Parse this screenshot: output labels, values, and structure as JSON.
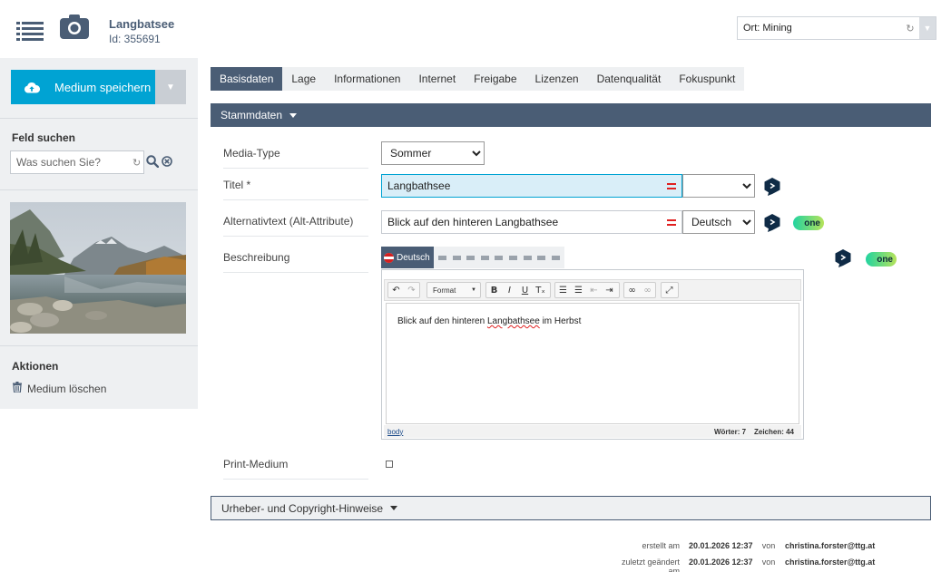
{
  "header": {
    "title": "Langbatsee",
    "id_label": "Id: 355691",
    "location_select": "Ort: Mining"
  },
  "sidebar": {
    "save_label": "Medium speichern",
    "search_heading": "Feld suchen",
    "search_placeholder": "Was suchen Sie?",
    "actions_heading": "Aktionen",
    "delete_label": "Medium löschen"
  },
  "tabs": [
    {
      "label": "Basisdaten",
      "active": true
    },
    {
      "label": "Lage"
    },
    {
      "label": "Informationen"
    },
    {
      "label": "Internet"
    },
    {
      "label": "Freigabe"
    },
    {
      "label": "Lizenzen"
    },
    {
      "label": "Datenqualität"
    },
    {
      "label": "Fokuspunkt"
    }
  ],
  "section": {
    "title": "Stammdaten"
  },
  "fields": {
    "media_type": {
      "label": "Media-Type",
      "value": "Sommer"
    },
    "title": {
      "label": "Titel *",
      "value": "Langbathsee",
      "lang": ""
    },
    "alt_text": {
      "label": "Alternativtext (Alt-Attribute)",
      "value": "Blick auf den hinteren Langbathsee",
      "lang": "Deutsch"
    },
    "description": {
      "label": "Beschreibung",
      "lang_tab": "Deutsch"
    },
    "print": {
      "label": "Print-Medium"
    }
  },
  "editor": {
    "format_label": "Format",
    "content_before": "Blick auf den hinteren ",
    "content_misspelled": "Langbathsee",
    "content_after": " im Herbst",
    "path": "body",
    "word_count": "Wörter: 7",
    "char_count": "Zeichen: 44"
  },
  "badges": {
    "one_label": "one"
  },
  "copyright": {
    "title": "Urheber- und Copyright-Hinweise"
  },
  "meta": {
    "created_label": "erstellt am",
    "created_date": "20.01.2026  12:37",
    "created_von": "von",
    "created_user": "christina.forster@ttg.at",
    "changed_label": "zuletzt geändert am",
    "changed_date": "20.01.2026  12:37",
    "changed_von": "von",
    "changed_user": "christina.forster@ttg.at"
  },
  "colors": {
    "primary": "#4a5d75",
    "accent": "#00a3d3",
    "sidebar_bg": "#eef0f2",
    "required_marker": "#e02020"
  }
}
